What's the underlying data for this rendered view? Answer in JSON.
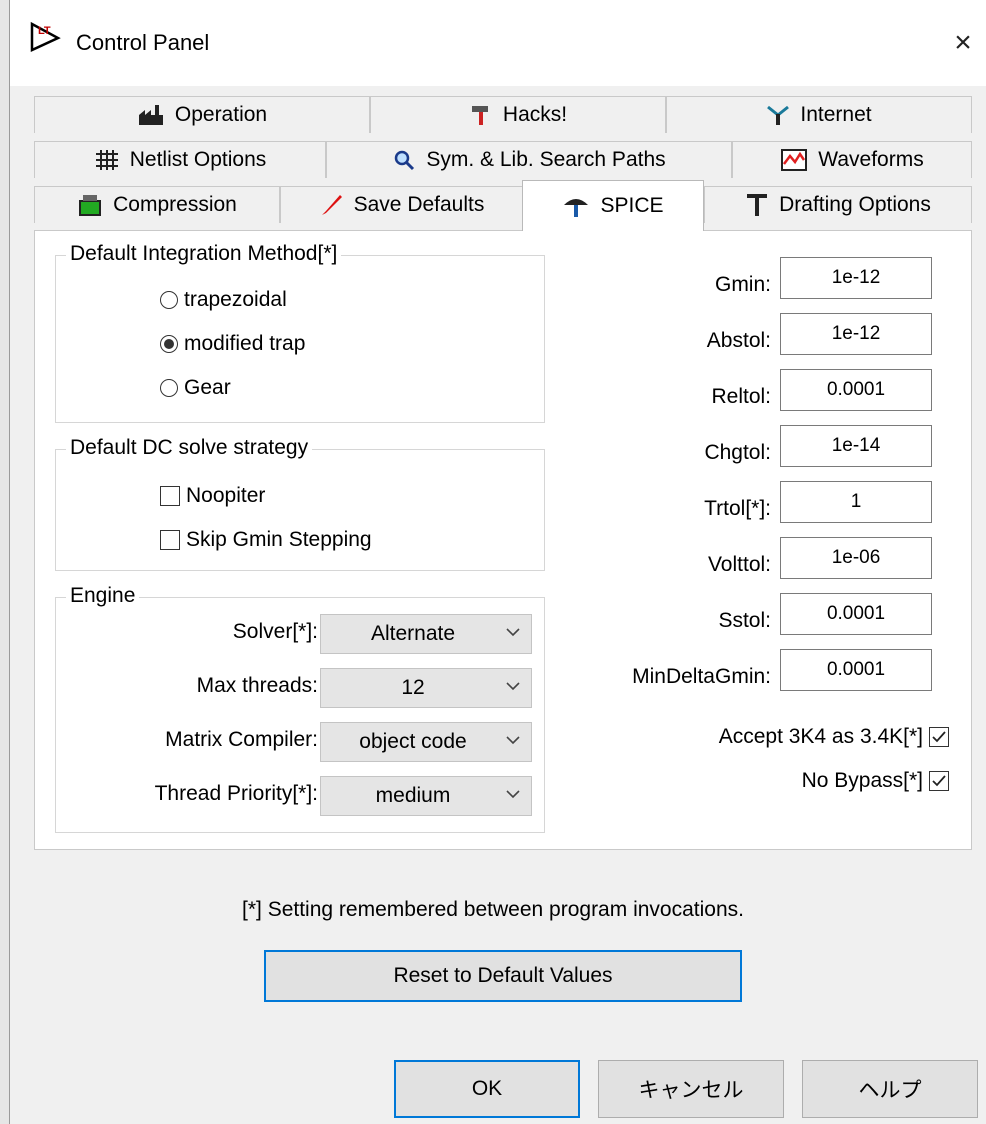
{
  "window": {
    "title": "Control Panel",
    "close_glyph": "×"
  },
  "tabs": {
    "row1": [
      {
        "label": "Operation",
        "icon": "factory-icon"
      },
      {
        "label": "Hacks!",
        "icon": "hammer-icon"
      },
      {
        "label": "Internet",
        "icon": "antenna-icon"
      }
    ],
    "row2": [
      {
        "label": "Netlist Options",
        "icon": "grid-icon"
      },
      {
        "label": "Sym. & Lib. Search Paths",
        "icon": "magnifier-icon"
      },
      {
        "label": "Waveforms",
        "icon": "waveform-icon"
      }
    ],
    "row3": [
      {
        "label": "Compression",
        "icon": "compression-icon"
      },
      {
        "label": "Save Defaults",
        "icon": "pen-icon"
      },
      {
        "label": "SPICE",
        "icon": "umbrella-icon",
        "active": true
      },
      {
        "label": "Drafting Options",
        "icon": "t-square-icon"
      }
    ]
  },
  "integration": {
    "legend": "Default Integration Method[*]",
    "options": [
      {
        "label": "trapezoidal",
        "selected": false
      },
      {
        "label": "modified trap",
        "selected": true
      },
      {
        "label": "Gear",
        "selected": false
      }
    ]
  },
  "dc_solve": {
    "legend": "Default DC solve strategy",
    "options": [
      {
        "label": "Noopiter",
        "checked": false
      },
      {
        "label": "Skip Gmin Stepping",
        "checked": false
      }
    ]
  },
  "engine": {
    "legend": "Engine",
    "rows": [
      {
        "label": "Solver[*]:",
        "value": "Alternate"
      },
      {
        "label": "Max threads:",
        "value": "12"
      },
      {
        "label": "Matrix Compiler:",
        "value": "object code"
      },
      {
        "label": "Thread Priority[*]:",
        "value": "medium"
      }
    ]
  },
  "params": [
    {
      "label": "Gmin:",
      "value": "1e-12"
    },
    {
      "label": "Abstol:",
      "value": "1e-12"
    },
    {
      "label": "Reltol:",
      "value": "0.0001"
    },
    {
      "label": "Chgtol:",
      "value": "1e-14"
    },
    {
      "label": "Trtol[*]:",
      "value": "1"
    },
    {
      "label": "Volttol:",
      "value": "1e-06"
    },
    {
      "label": "Sstol:",
      "value": "0.0001"
    },
    {
      "label": "MinDeltaGmin:",
      "value": "0.0001"
    }
  ],
  "flags": [
    {
      "label": "Accept 3K4 as 3.4K[*]",
      "checked": true
    },
    {
      "label": "No Bypass[*]",
      "checked": true
    }
  ],
  "footnote": "[*] Setting remembered between program invocations.",
  "reset_label": "Reset to Default Values",
  "buttons": {
    "ok": "OK",
    "cancel": "キャンセル",
    "help": "ヘルプ"
  },
  "colors": {
    "accent": "#0078d7",
    "panel_bg": "#f0f0f0",
    "waveform_red": "#e02020",
    "compression_green": "#22aa22"
  }
}
